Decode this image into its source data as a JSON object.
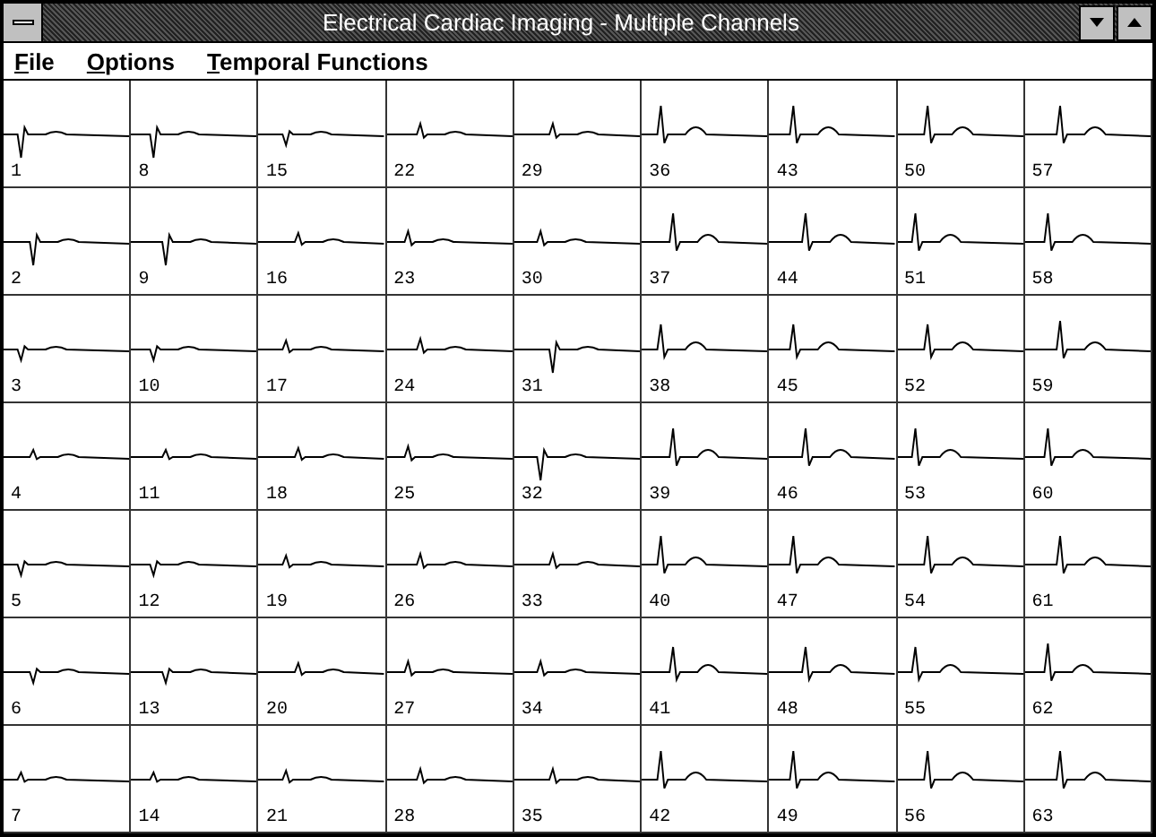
{
  "window": {
    "title": "Electrical Cardiac Imaging - Multiple Channels"
  },
  "menu": [
    "File",
    "Options",
    "Temporal Functions"
  ],
  "channels": [
    "1",
    "8",
    "15",
    "22",
    "29",
    "36",
    "43",
    "50",
    "57",
    "2",
    "9",
    "16",
    "23",
    "30",
    "37",
    "44",
    "51",
    "58",
    "3",
    "10",
    "17",
    "24",
    "31",
    "38",
    "45",
    "52",
    "59",
    "4",
    "11",
    "18",
    "25",
    "32",
    "39",
    "46",
    "53",
    "60",
    "5",
    "12",
    "19",
    "26",
    "33",
    "40",
    "47",
    "54",
    "61",
    "6",
    "13",
    "20",
    "27",
    "34",
    "41",
    "48",
    "55",
    "62",
    "7",
    "14",
    "21",
    "28",
    "35",
    "42",
    "49",
    "56",
    "63"
  ]
}
